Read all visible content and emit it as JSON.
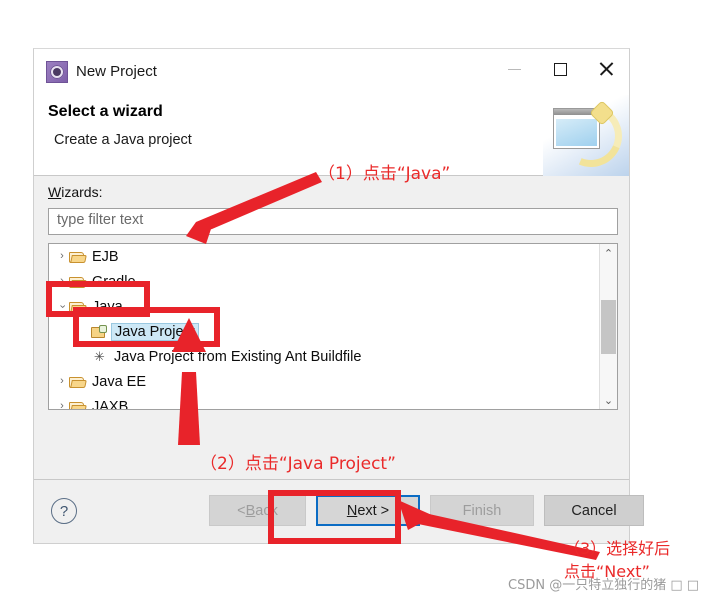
{
  "window": {
    "title": "New Project",
    "icon": "eclipse-wizard-icon",
    "controls": {
      "minimize": "minimize-icon",
      "maximize": "maximize-icon",
      "close": "close-icon"
    }
  },
  "header": {
    "title": "Select a wizard",
    "subtitle": "Create a Java project",
    "banner_icon": "wizard-banner-icon"
  },
  "content": {
    "wizards_label_accel": "W",
    "wizards_label_rest": "izards:",
    "filter_placeholder": "type filter text",
    "filter_value": "",
    "tree": [
      {
        "label": "EJB",
        "indent": 1,
        "twisty": "›",
        "expanded": false,
        "icon": "folder-icon",
        "selected": false
      },
      {
        "label": "Gradle",
        "indent": 1,
        "twisty": "›",
        "expanded": false,
        "icon": "folder-icon",
        "selected": false
      },
      {
        "label": "Java",
        "indent": 1,
        "twisty": "›",
        "expanded": true,
        "icon": "folder-icon",
        "selected": false
      },
      {
        "label": "Java Project",
        "indent": 2,
        "twisty": "",
        "expanded": false,
        "icon": "java-project-icon",
        "selected": true
      },
      {
        "label": "Java Project from Existing Ant Buildfile",
        "indent": 2,
        "twisty": "",
        "expanded": false,
        "icon": "ant-buildfile-icon",
        "selected": false
      },
      {
        "label": "Java EE",
        "indent": 1,
        "twisty": "›",
        "expanded": false,
        "icon": "folder-icon",
        "selected": false
      },
      {
        "label": "JAXB",
        "indent": 1,
        "twisty": "›",
        "expanded": false,
        "icon": "folder-icon",
        "selected": false
      }
    ],
    "scrollbar": {
      "up": "⌃",
      "down": "⌄"
    }
  },
  "footer": {
    "help": "?",
    "back_accel": "B",
    "back_prefix": "< ",
    "back_rest": "ack",
    "next_accel": "N",
    "next_rest": "ext >",
    "finish": "Finish",
    "cancel": "Cancel"
  },
  "annotations": {
    "step1": "（1）点击“Java”",
    "step2": "（2）点击“Java Project”",
    "step3_line1": "（3）选择好后",
    "step3_line2": "点击“Next”",
    "color": "#ea2a2a"
  },
  "watermark": "CSDN @一只特立独行的猪 □ □"
}
